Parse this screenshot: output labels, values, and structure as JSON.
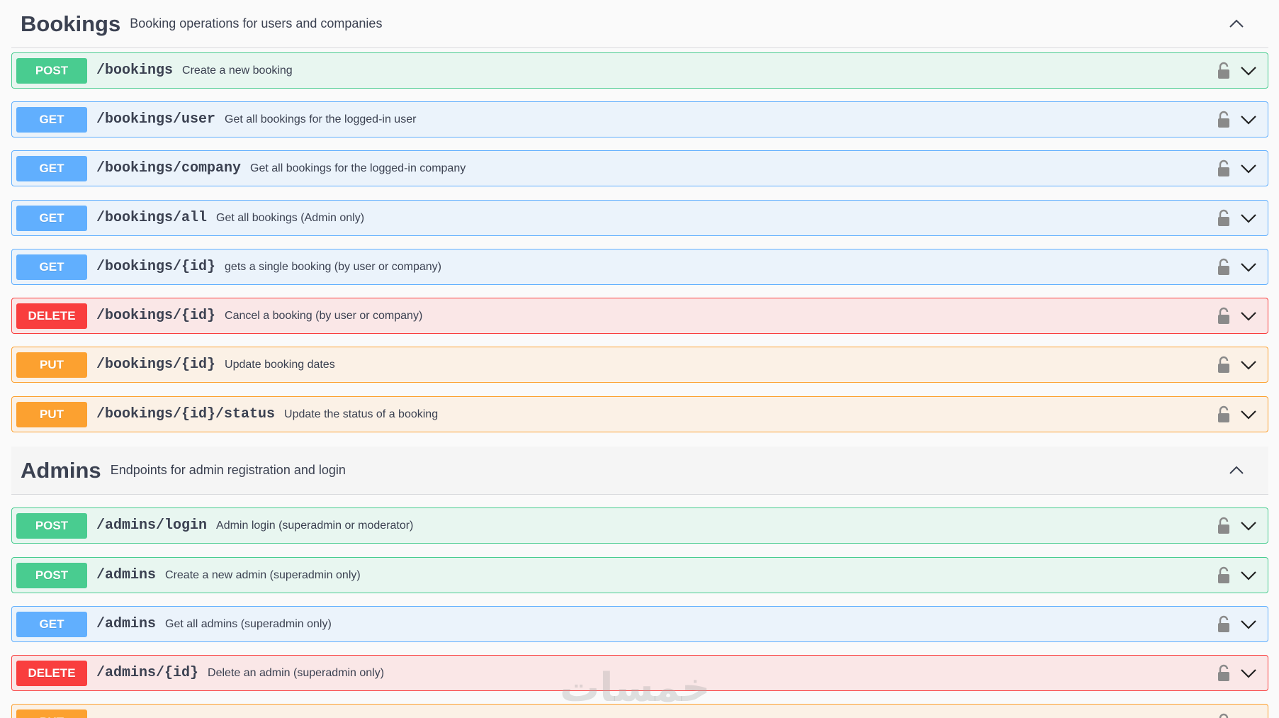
{
  "tags": [
    {
      "title": "Bookings",
      "description": "Booking operations for users and companies",
      "operations": [
        {
          "method": "POST",
          "path": "/bookings",
          "summary": "Create a new booking"
        },
        {
          "method": "GET",
          "path": "/bookings/user",
          "summary": "Get all bookings for the logged-in user"
        },
        {
          "method": "GET",
          "path": "/bookings/company",
          "summary": "Get all bookings for the logged-in company"
        },
        {
          "method": "GET",
          "path": "/bookings/all",
          "summary": "Get all bookings (Admin only)"
        },
        {
          "method": "GET",
          "path": "/bookings/{id}",
          "summary": "gets a single booking (by user or company)"
        },
        {
          "method": "DELETE",
          "path": "/bookings/{id}",
          "summary": "Cancel a booking (by user or company)"
        },
        {
          "method": "PUT",
          "path": "/bookings/{id}",
          "summary": "Update booking dates"
        },
        {
          "method": "PUT",
          "path": "/bookings/{id}/status",
          "summary": "Update the status of a booking"
        }
      ]
    },
    {
      "title": "Admins",
      "description": "Endpoints for admin registration and login",
      "operations": [
        {
          "method": "POST",
          "path": "/admins/login",
          "summary": "Admin login (superadmin or moderator)"
        },
        {
          "method": "POST",
          "path": "/admins",
          "summary": "Create a new admin (superadmin only)"
        },
        {
          "method": "GET",
          "path": "/admins",
          "summary": "Get all admins (superadmin only)"
        },
        {
          "method": "DELETE",
          "path": "/admins/{id}",
          "summary": "Delete an admin (superadmin only)"
        },
        {
          "method": "PUT",
          "path": "",
          "summary": ""
        }
      ]
    }
  ],
  "watermark": "خمسات",
  "colors": {
    "post": "#49cc90",
    "get": "#61affe",
    "delete": "#f93e3e",
    "put": "#fca130",
    "text": "#3b4151"
  },
  "icons": {
    "lock": "lock-icon",
    "expand": "chevron-down-icon",
    "collapse": "chevron-up-icon"
  }
}
